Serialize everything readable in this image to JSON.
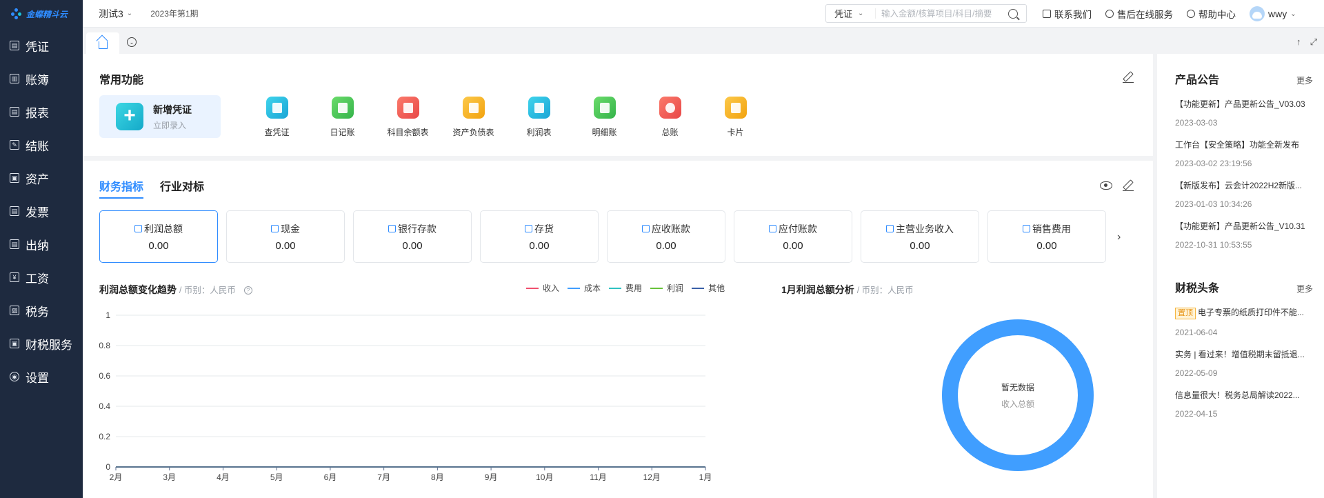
{
  "brand": "金蝶精斗云",
  "sidebar": {
    "items": [
      {
        "label": "凭证",
        "glyph": "▤"
      },
      {
        "label": "账簿",
        "glyph": "▥"
      },
      {
        "label": "报表",
        "glyph": "▤"
      },
      {
        "label": "结账",
        "glyph": "✎"
      },
      {
        "label": "资产",
        "glyph": "▣"
      },
      {
        "label": "发票",
        "glyph": "▤"
      },
      {
        "label": "出纳",
        "glyph": "▤"
      },
      {
        "label": "工资",
        "glyph": "¥"
      },
      {
        "label": "税务",
        "glyph": "▨"
      },
      {
        "label": "财税服务",
        "glyph": "▣"
      },
      {
        "label": "设置",
        "glyph": "◉"
      }
    ]
  },
  "topbar": {
    "account": "测试3",
    "period": "2023年第1期",
    "search_type": "凭证",
    "search_placeholder": "输入金额/核算项目/科目/摘要",
    "contact": "联系我们",
    "support": "售后在线服务",
    "help": "帮助中心",
    "user": "wwy"
  },
  "common": {
    "title": "常用功能",
    "new_voucher": {
      "title": "新增凭证",
      "subtitle": "立即录入"
    },
    "items": [
      {
        "label": "查凭证",
        "color": "#22c1e0"
      },
      {
        "label": "日记账",
        "color": "#4fc94f"
      },
      {
        "label": "科目余额表",
        "color": "#f05b5b"
      },
      {
        "label": "资产负债表",
        "color": "#f6b21f"
      },
      {
        "label": "利润表",
        "color": "#22c1e0"
      },
      {
        "label": "明细账",
        "color": "#4fc94f"
      },
      {
        "label": "总账",
        "color": "#f05b5b"
      },
      {
        "label": "卡片",
        "color": "#f6b21f"
      }
    ]
  },
  "finance": {
    "tabs": [
      "财务指标",
      "行业对标"
    ],
    "cards": [
      {
        "label": "利润总额",
        "value": "0.00"
      },
      {
        "label": "现金",
        "value": "0.00"
      },
      {
        "label": "银行存款",
        "value": "0.00"
      },
      {
        "label": "存货",
        "value": "0.00"
      },
      {
        "label": "应收账款",
        "value": "0.00"
      },
      {
        "label": "应付账款",
        "value": "0.00"
      },
      {
        "label": "主营业务收入",
        "value": "0.00"
      },
      {
        "label": "销售费用",
        "value": "0.00"
      }
    ],
    "trend_title": "利润总额变化趋势",
    "trend_sub": "/ 币别：人民币",
    "analysis_title": "1月利润总额分析",
    "analysis_sub": "/ 币别：人民币",
    "donut_empty": "暂无数据",
    "donut_label": "收入总额"
  },
  "chart_data": {
    "type": "line",
    "categories": [
      "2月",
      "3月",
      "4月",
      "5月",
      "6月",
      "7月",
      "8月",
      "9月",
      "10月",
      "11月",
      "12月",
      "1月"
    ],
    "series": [
      {
        "name": "收入",
        "color": "#f0506e",
        "values": [
          0,
          0,
          0,
          0,
          0,
          0,
          0,
          0,
          0,
          0,
          0,
          0
        ]
      },
      {
        "name": "成本",
        "color": "#409eff",
        "values": [
          0,
          0,
          0,
          0,
          0,
          0,
          0,
          0,
          0,
          0,
          0,
          0
        ]
      },
      {
        "name": "费用",
        "color": "#2fc2c2",
        "values": [
          0,
          0,
          0,
          0,
          0,
          0,
          0,
          0,
          0,
          0,
          0,
          0
        ]
      },
      {
        "name": "利润",
        "color": "#67c23a",
        "values": [
          0,
          0,
          0,
          0,
          0,
          0,
          0,
          0,
          0,
          0,
          0,
          0
        ]
      },
      {
        "name": "其他",
        "color": "#3a5fa8",
        "values": [
          0,
          0,
          0,
          0,
          0,
          0,
          0,
          0,
          0,
          0,
          0,
          0
        ]
      }
    ],
    "yticks": [
      "0",
      "0.2",
      "0.4",
      "0.6",
      "0.8",
      "1"
    ],
    "ylim": [
      0,
      1
    ],
    "grid": true
  },
  "notices": {
    "title": "产品公告",
    "more": "更多",
    "items": [
      {
        "title": "【功能更新】产品更新公告_V03.03",
        "date": "2023-03-03"
      },
      {
        "title": "工作台【安全策略】功能全新发布",
        "date": "2023-03-02 23:19:56"
      },
      {
        "title": "【新版发布】云会计2022H2新版...",
        "date": "2023-01-03 10:34:26"
      },
      {
        "title": "【功能更新】产品更新公告_V10.31",
        "date": "2022-10-31 10:53:55"
      }
    ]
  },
  "news": {
    "title": "财税头条",
    "more": "更多",
    "pin": "置顶",
    "items": [
      {
        "title": "电子专票的纸质打印件不能...",
        "date": "2021-06-04"
      },
      {
        "title": "实务 | 看过来！增值税期末留抵退...",
        "date": "2022-05-09"
      },
      {
        "title": "信息量很大！税务总局解读2022...",
        "date": "2022-04-15"
      }
    ]
  }
}
